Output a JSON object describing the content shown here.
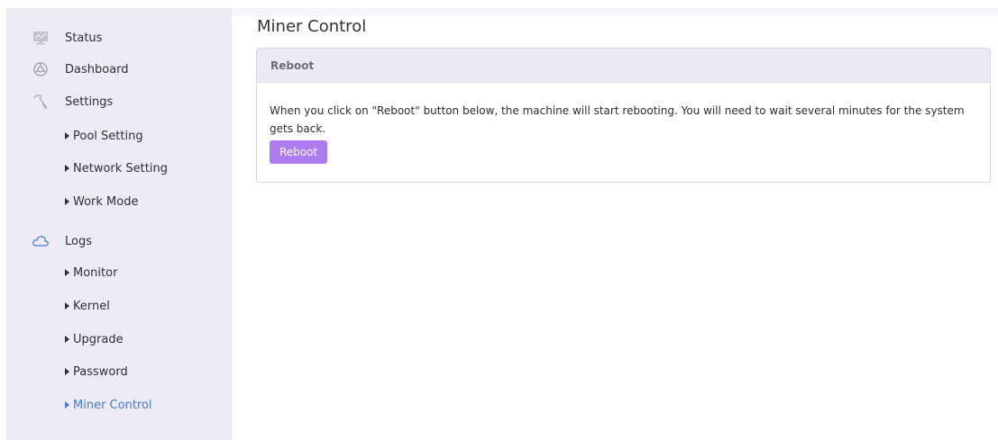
{
  "sidebar": {
    "status": "Status",
    "dashboard": "Dashboard",
    "settings": "Settings",
    "settings_items": [
      "Pool Setting",
      "Network Setting",
      "Work Mode"
    ],
    "logs": "Logs",
    "logs_items": [
      "Monitor",
      "Kernel",
      "Upgrade",
      "Password",
      "Miner Control"
    ],
    "active_item": "Miner Control"
  },
  "main": {
    "page_title": "Miner Control",
    "card": {
      "header": "Reboot",
      "description": "When you click on \"Reboot\" button below, the machine will start rebooting. You will need to wait several minutes for the system gets back.",
      "button_label": "Reboot"
    }
  },
  "colors": {
    "sidebar_bg": "#edecf4",
    "active_link": "#4a78d6",
    "button": "#ad7cf0",
    "card_header_bg": "#ecebf3"
  },
  "icons": {
    "status": "monitor-icon",
    "dashboard": "dashboard-icon",
    "settings": "wrench-icon",
    "logs": "cloud-icon"
  }
}
